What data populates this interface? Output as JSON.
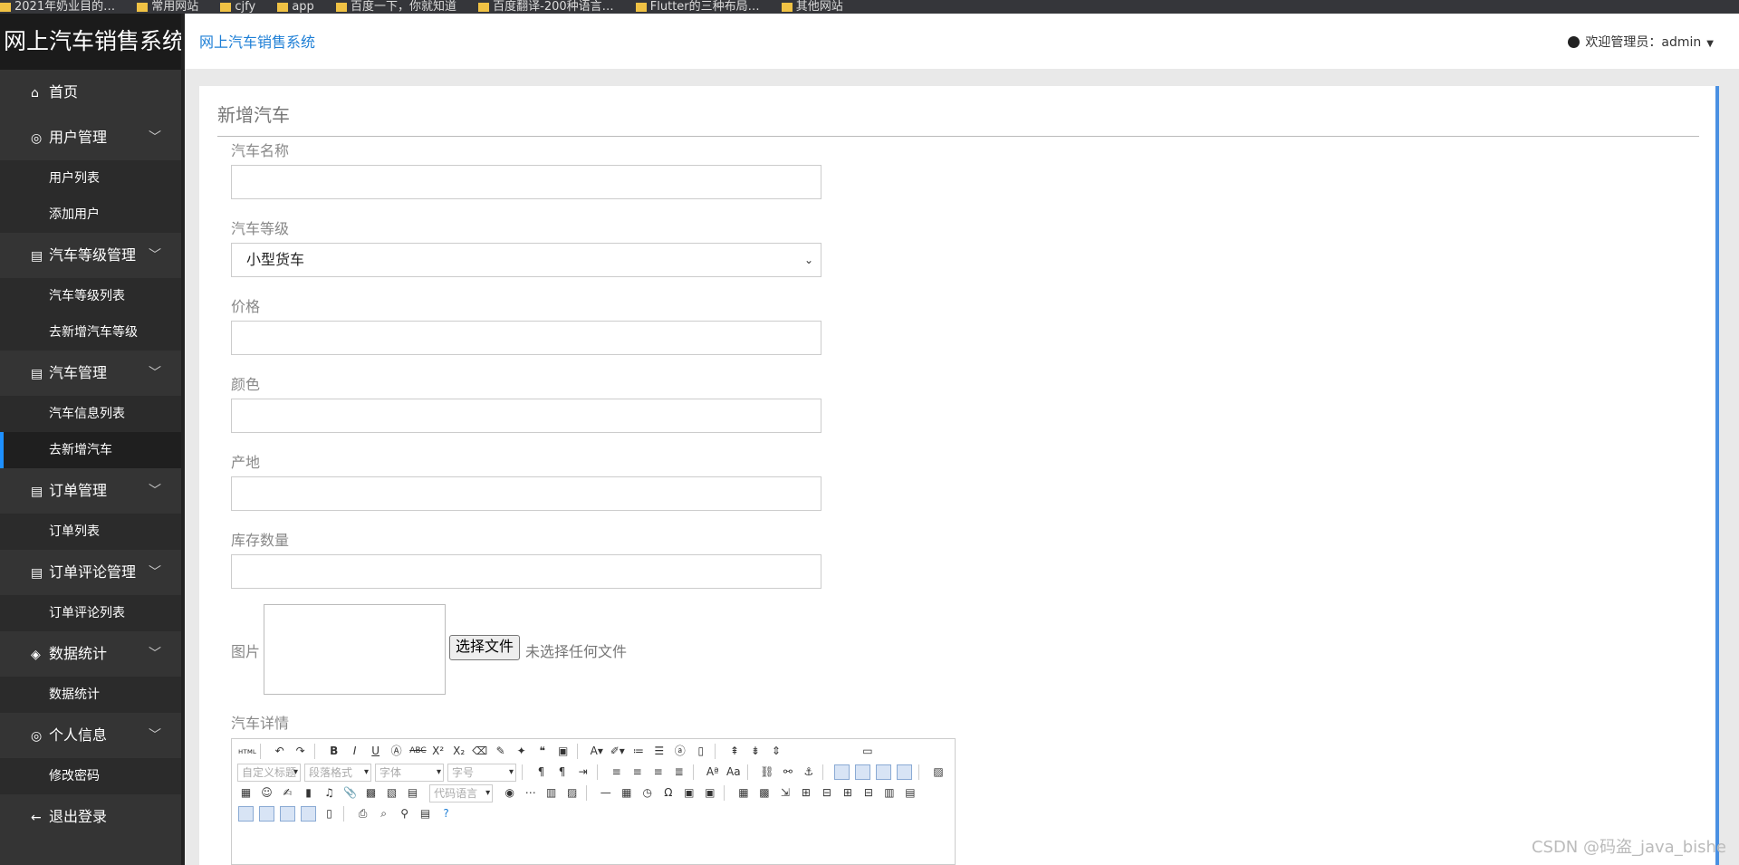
{
  "bookmarks": [
    "2021年奶业目的…",
    "常用网站",
    "cjfy",
    "app",
    "百度一下，你就知道",
    "百度翻译-200种语言…",
    "Flutter的三种布局…",
    "其他网站"
  ],
  "sidebar": {
    "brand": "网上汽车销售系统",
    "home": "首页",
    "groups": [
      {
        "label": "用户管理",
        "items": [
          "用户列表",
          "添加用户"
        ]
      },
      {
        "label": "汽车等级管理",
        "items": [
          "汽车等级列表",
          "去新增汽车等级"
        ]
      },
      {
        "label": "汽车管理",
        "items": [
          "汽车信息列表",
          "去新增汽车"
        ]
      },
      {
        "label": "订单管理",
        "items": [
          "订单列表"
        ]
      },
      {
        "label": "订单评论管理",
        "items": [
          "订单评论列表"
        ]
      },
      {
        "label": "数据统计",
        "items": [
          "数据统计"
        ]
      },
      {
        "label": "个人信息",
        "items": [
          "修改密码"
        ]
      }
    ],
    "logout": "退出登录",
    "active_item": "去新增汽车"
  },
  "header": {
    "breadcrumb": "网上汽车销售系统",
    "welcome": "欢迎管理员：admin"
  },
  "form": {
    "title": "新增汽车",
    "name_label": "汽车名称",
    "name_value": "",
    "grade_label": "汽车等级",
    "grade_value": "小型货车",
    "price_label": "价格",
    "price_value": "",
    "color_label": "颜色",
    "color_value": "",
    "origin_label": "产地",
    "origin_value": "",
    "stock_label": "库存数量",
    "stock_value": "",
    "image_label": "图片",
    "file_button": "选择文件",
    "file_status": "未选择任何文件",
    "detail_label": "汽车详情"
  },
  "editor": {
    "dropdowns": [
      "自定义标题",
      "段落格式",
      "字体",
      "字号",
      "代码语言"
    ]
  },
  "watermark": "CSDN @码盗_java_bishe"
}
